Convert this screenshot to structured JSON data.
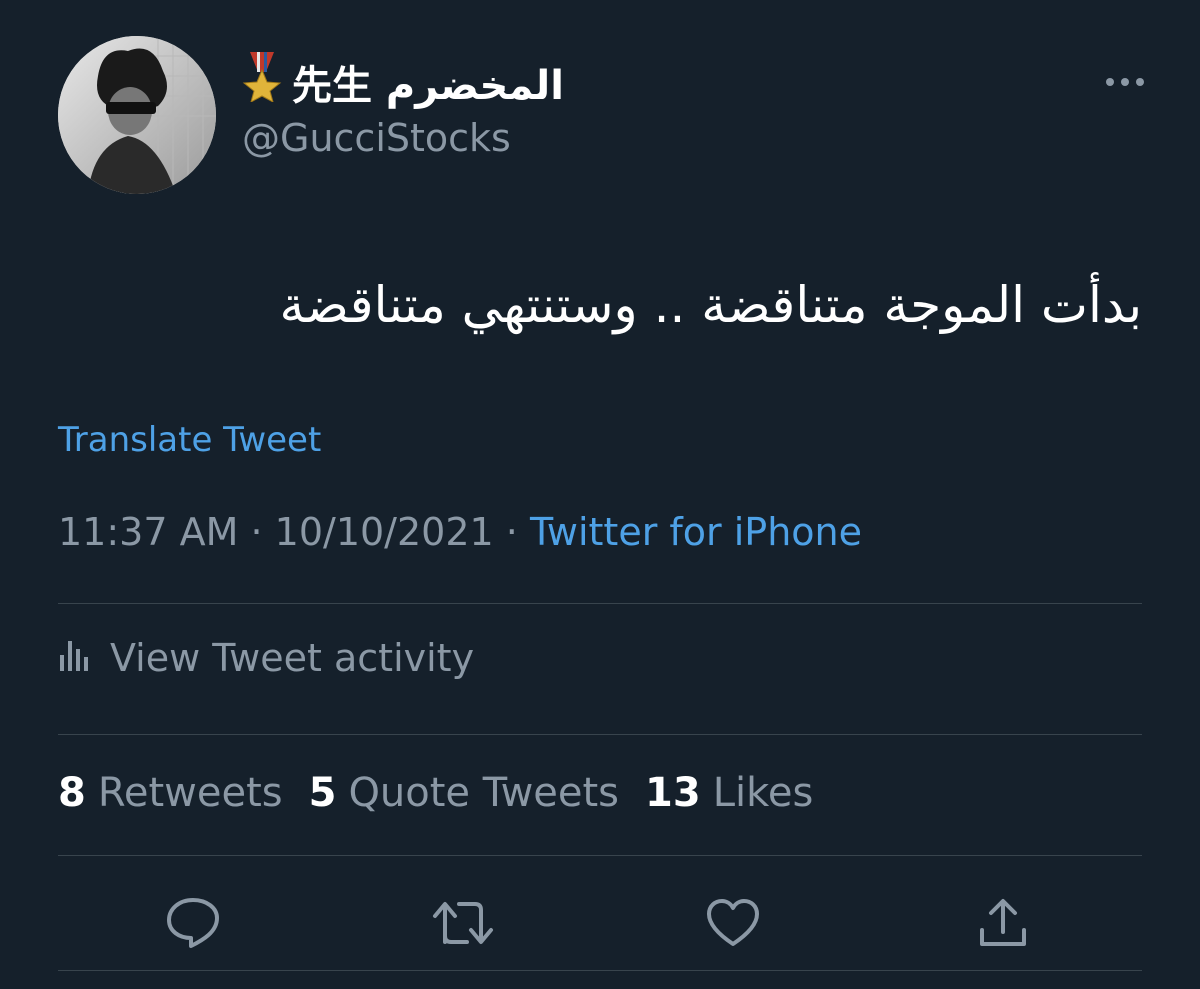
{
  "user": {
    "display_name": "المخضرم 先生",
    "badge_icon": "military-medal-icon",
    "handle": "@GucciStocks",
    "avatar_icon": "profile-photo"
  },
  "tweet": {
    "text": "بدأت الموجة متناقضة .. وستنتهي متناقضة",
    "translate_label": "Translate Tweet",
    "time": "11:37 AM",
    "date": "10/10/2021",
    "separator": "·",
    "source": "Twitter for iPhone"
  },
  "activity": {
    "label": "View Tweet activity",
    "icon": "bar-chart-icon"
  },
  "stats": {
    "retweets_count": "8",
    "retweets_label": "Retweets",
    "quotes_count": "5",
    "quotes_label": "Quote Tweets",
    "likes_count": "13",
    "likes_label": "Likes"
  },
  "actions": [
    "reply-icon",
    "retweet-icon",
    "like-icon",
    "share-icon"
  ],
  "colors": {
    "background": "#15202b",
    "link": "#4ea1e6",
    "muted": "#8b98a5",
    "divider": "#38444d"
  }
}
